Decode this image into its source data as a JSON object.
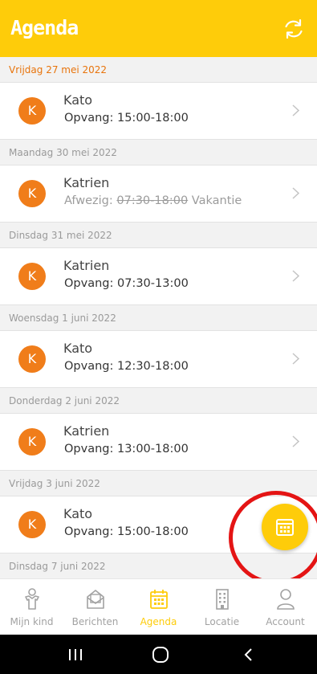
{
  "header": {
    "title": "Agenda",
    "refresh_icon": "refresh-icon",
    "color": "#fecc0a"
  },
  "days": [
    {
      "date": "Vrijdag 27 mei 2022",
      "entries": [
        {
          "initial": "K",
          "name": "Kato",
          "label": "Opvang:",
          "time": "15:00-18:00",
          "extra": "",
          "absent": false
        }
      ]
    },
    {
      "date": "Maandag 30 mei 2022",
      "entries": [
        {
          "initial": "K",
          "name": "Katrien",
          "label": "Afwezig:",
          "time": "07:30-18:00",
          "extra": "Vakantie",
          "absent": true
        }
      ]
    },
    {
      "date": "Dinsdag 31 mei 2022",
      "entries": [
        {
          "initial": "K",
          "name": "Katrien",
          "label": "Opvang:",
          "time": "07:30-13:00",
          "extra": "",
          "absent": false
        }
      ]
    },
    {
      "date": "Woensdag 1 juni 2022",
      "entries": [
        {
          "initial": "K",
          "name": "Kato",
          "label": "Opvang:",
          "time": "12:30-18:00",
          "extra": "",
          "absent": false
        }
      ]
    },
    {
      "date": "Donderdag 2 juni 2022",
      "entries": [
        {
          "initial": "K",
          "name": "Katrien",
          "label": "Opvang:",
          "time": "13:00-18:00",
          "extra": "",
          "absent": false
        }
      ]
    },
    {
      "date": "Vrijdag 3 juni 2022",
      "entries": [
        {
          "initial": "K",
          "name": "Kato",
          "label": "Opvang:",
          "time": "15:00-18:00",
          "extra": "",
          "absent": false
        }
      ]
    },
    {
      "date": "Dinsdag 7 juni 2022",
      "entries": []
    }
  ],
  "fab": {
    "icon": "calendar-icon"
  },
  "tabs": [
    {
      "label": "Mijn kind",
      "icon": "child-icon",
      "active": false
    },
    {
      "label": "Berichten",
      "icon": "envelope-icon",
      "active": false
    },
    {
      "label": "Agenda",
      "icon": "calendar-icon",
      "active": true
    },
    {
      "label": "Locatie",
      "icon": "building-icon",
      "active": false
    },
    {
      "label": "Account",
      "icon": "person-icon",
      "active": false
    }
  ],
  "colors": {
    "accent": "#fecc0a",
    "avatar": "#f07d1a",
    "date_accent": "#e8740c",
    "highlight": "#e41414"
  }
}
